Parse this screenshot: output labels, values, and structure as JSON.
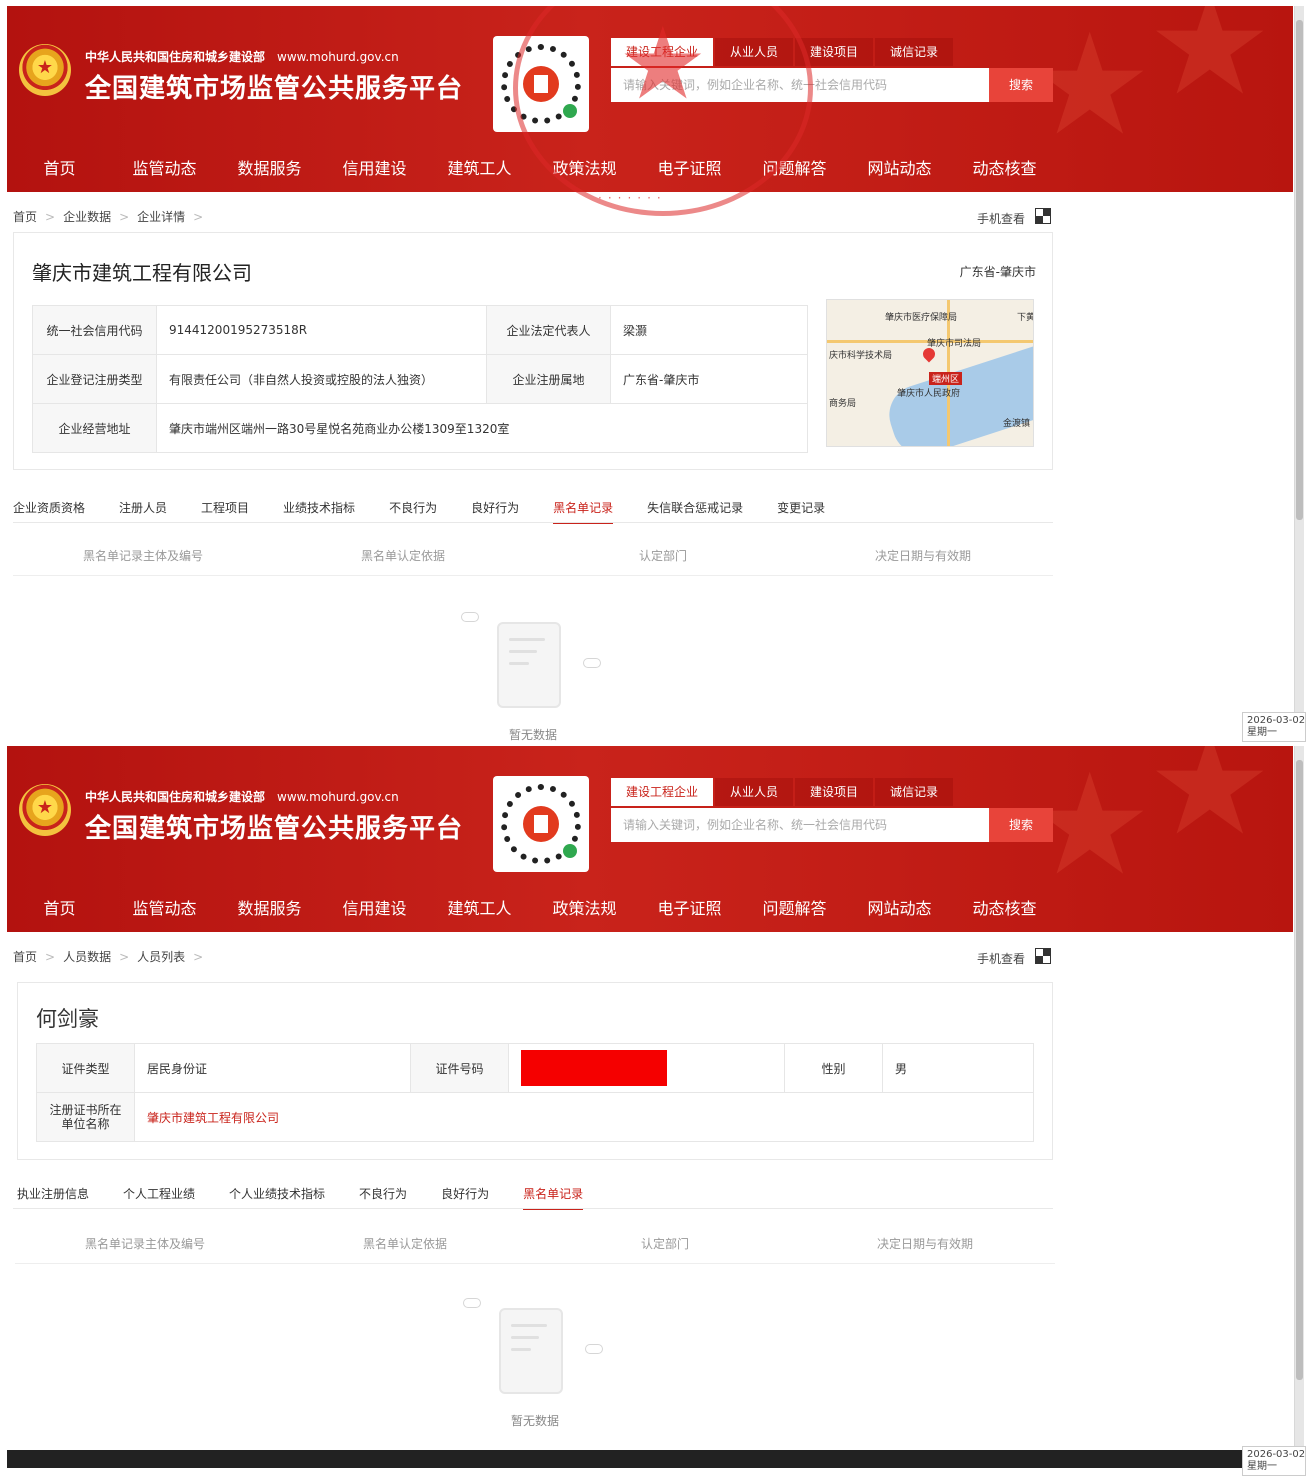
{
  "header": {
    "ministry": "中华人民共和国住房和城乡建设部",
    "url": "www.mohurd.gov.cn",
    "platform": "全国建筑市场监管公共服务平台",
    "search_tabs": [
      "建设工程企业",
      "从业人员",
      "建设项目",
      "诚信记录"
    ],
    "search_placeholder": "请输入关键词，例如企业名称、统一社会信用代码",
    "search_button": "搜索",
    "nav": [
      "首页",
      "监管动态",
      "数据服务",
      "信用建设",
      "建筑工人",
      "政策法规",
      "电子证照",
      "问题解答",
      "网站动态",
      "动态核查"
    ]
  },
  "common": {
    "mobile_view": "手机查看",
    "empty_text": "暂无数据",
    "blacklist_columns": [
      "黑名单记录主体及编号",
      "黑名单认定依据",
      "认定部门",
      "决定日期与有效期"
    ],
    "date": "2026-03-02",
    "weekday": "星期一"
  },
  "company_page": {
    "breadcrumb": [
      "首页",
      "企业数据",
      "企业详情"
    ],
    "name": "肇庆市建筑工程有限公司",
    "region": "广东省-肇庆市",
    "fields": {
      "credit_code_label": "统一社会信用代码",
      "credit_code": "91441200195273518R",
      "legal_rep_label": "企业法定代表人",
      "legal_rep": "梁灏",
      "reg_type_label": "企业登记注册类型",
      "reg_type": "有限责任公司（非自然人投资或控股的法人独资）",
      "reg_place_label": "企业注册属地",
      "reg_place": "广东省-肇庆市",
      "address_label": "企业经营地址",
      "address": "肇庆市端州区端州一路30号星悦名苑商业办公楼1309至1320室"
    },
    "map_labels": [
      "肇庆市医疗保障局",
      "肇庆市司法局",
      "庆市科学技术局",
      "端州区",
      "肇庆市人民政府",
      "商务局",
      "金渡镇",
      "下黄"
    ],
    "tabs": [
      "企业资质资格",
      "注册人员",
      "工程项目",
      "业绩技术指标",
      "不良行为",
      "良好行为",
      "黑名单记录",
      "失信联合惩戒记录",
      "变更记录"
    ],
    "active_tab": "黑名单记录"
  },
  "person_page": {
    "breadcrumb": [
      "首页",
      "人员数据",
      "人员列表"
    ],
    "name": "何剑豪",
    "fields": {
      "id_type_label": "证件类型",
      "id_type": "居民身份证",
      "id_no_label": "证件号码",
      "gender_label": "性别",
      "gender": "男",
      "company_label_1": "注册证书所在",
      "company_label_2": "单位名称",
      "company": "肇庆市建筑工程有限公司"
    },
    "tabs": [
      "执业注册信息",
      "个人工程业绩",
      "个人业绩技术指标",
      "不良行为",
      "良好行为",
      "黑名单记录"
    ],
    "active_tab": "黑名单记录"
  },
  "colors": {
    "brand_red": "#c9231b",
    "redaction": "#f50000"
  }
}
